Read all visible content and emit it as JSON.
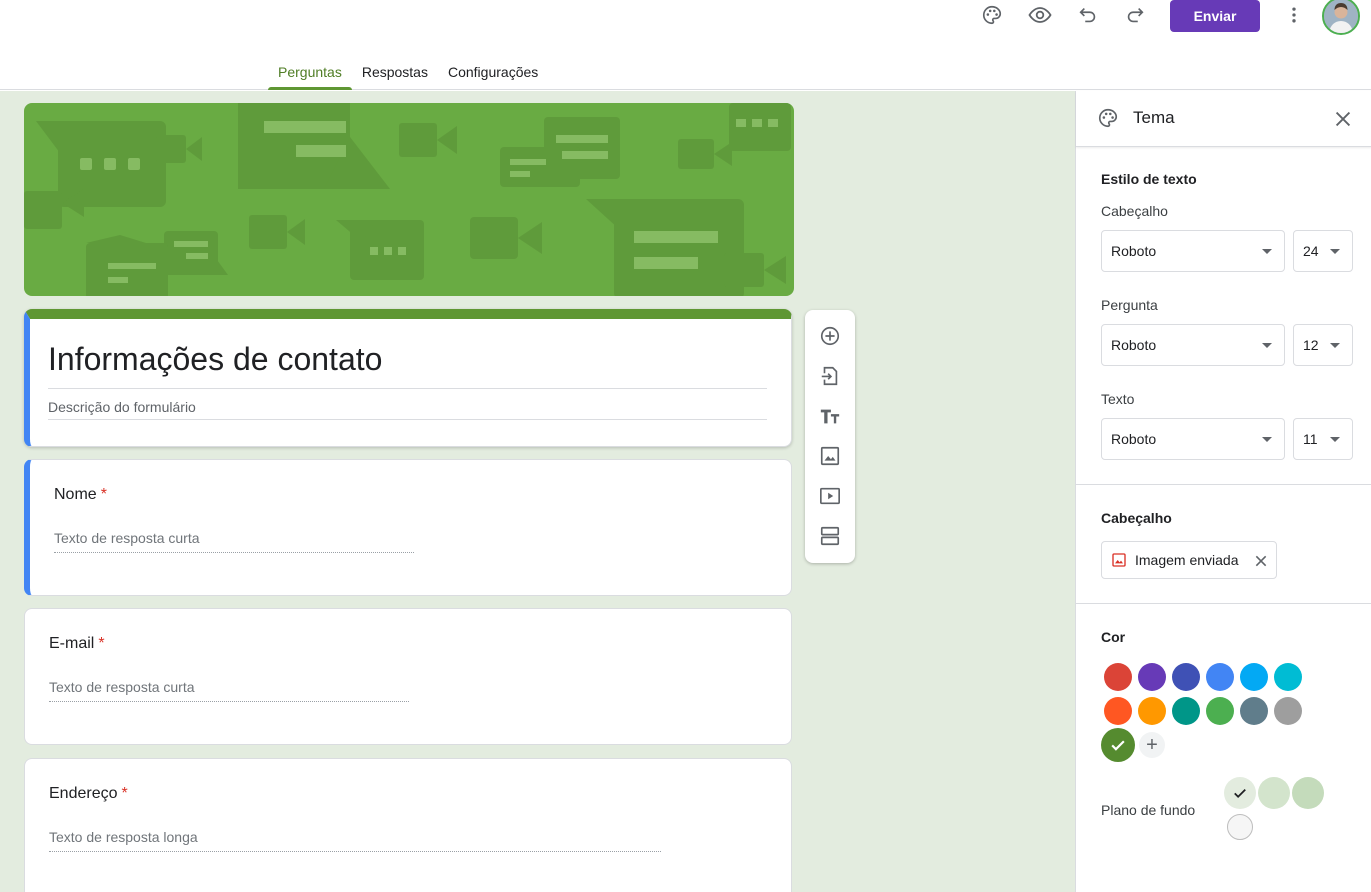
{
  "header": {
    "send_label": "Enviar",
    "icons": [
      "palette-icon",
      "eye-icon",
      "undo-icon",
      "redo-icon",
      "more-vert-icon"
    ],
    "accent_color": "#673ab7"
  },
  "tabs": [
    {
      "label": "Perguntas",
      "active": true
    },
    {
      "label": "Respostas",
      "active": false
    },
    {
      "label": "Configurações",
      "active": false
    }
  ],
  "form": {
    "title": "Informações de contato",
    "description": "Descrição do formulário",
    "questions": [
      {
        "label": "Nome",
        "required_mark": "*",
        "answer_hint": "Texto de resposta curta"
      },
      {
        "label": "E-mail",
        "required_mark": "*",
        "answer_hint": "Texto de resposta curta"
      },
      {
        "label": "Endereço",
        "required_mark": "*",
        "answer_hint": "Texto de resposta longa"
      }
    ]
  },
  "floating_toolbar": [
    "add-question-icon",
    "import-questions-icon",
    "add-title-icon",
    "add-image-icon",
    "add-video-icon",
    "add-section-icon"
  ],
  "theme_panel": {
    "title": "Tema",
    "text_style": {
      "heading": "Estilo de texto",
      "rows": [
        {
          "label": "Cabeçalho",
          "font": "Roboto",
          "size": "24"
        },
        {
          "label": "Pergunta",
          "font": "Roboto",
          "size": "12"
        },
        {
          "label": "Texto",
          "font": "Roboto",
          "size": "11"
        }
      ]
    },
    "header_section": {
      "heading": "Cabeçalho",
      "chip_label": "Imagem enviada"
    },
    "color_section": {
      "heading": "Cor",
      "colors": [
        "#db4437",
        "#673ab7",
        "#3f51b5",
        "#4285f4",
        "#03a9f4",
        "#00bcd4",
        "#ff5722",
        "#ff9800",
        "#009688",
        "#4caf50",
        "#607d8b",
        "#9e9e9e"
      ],
      "selected_color": "#558b2f"
    },
    "background": {
      "label": "Plano de fundo",
      "colors": [
        "#e3ecdf",
        "#d3e4cc",
        "#c4dbbb",
        "#f6f6f6"
      ],
      "selected_index": 0
    }
  }
}
